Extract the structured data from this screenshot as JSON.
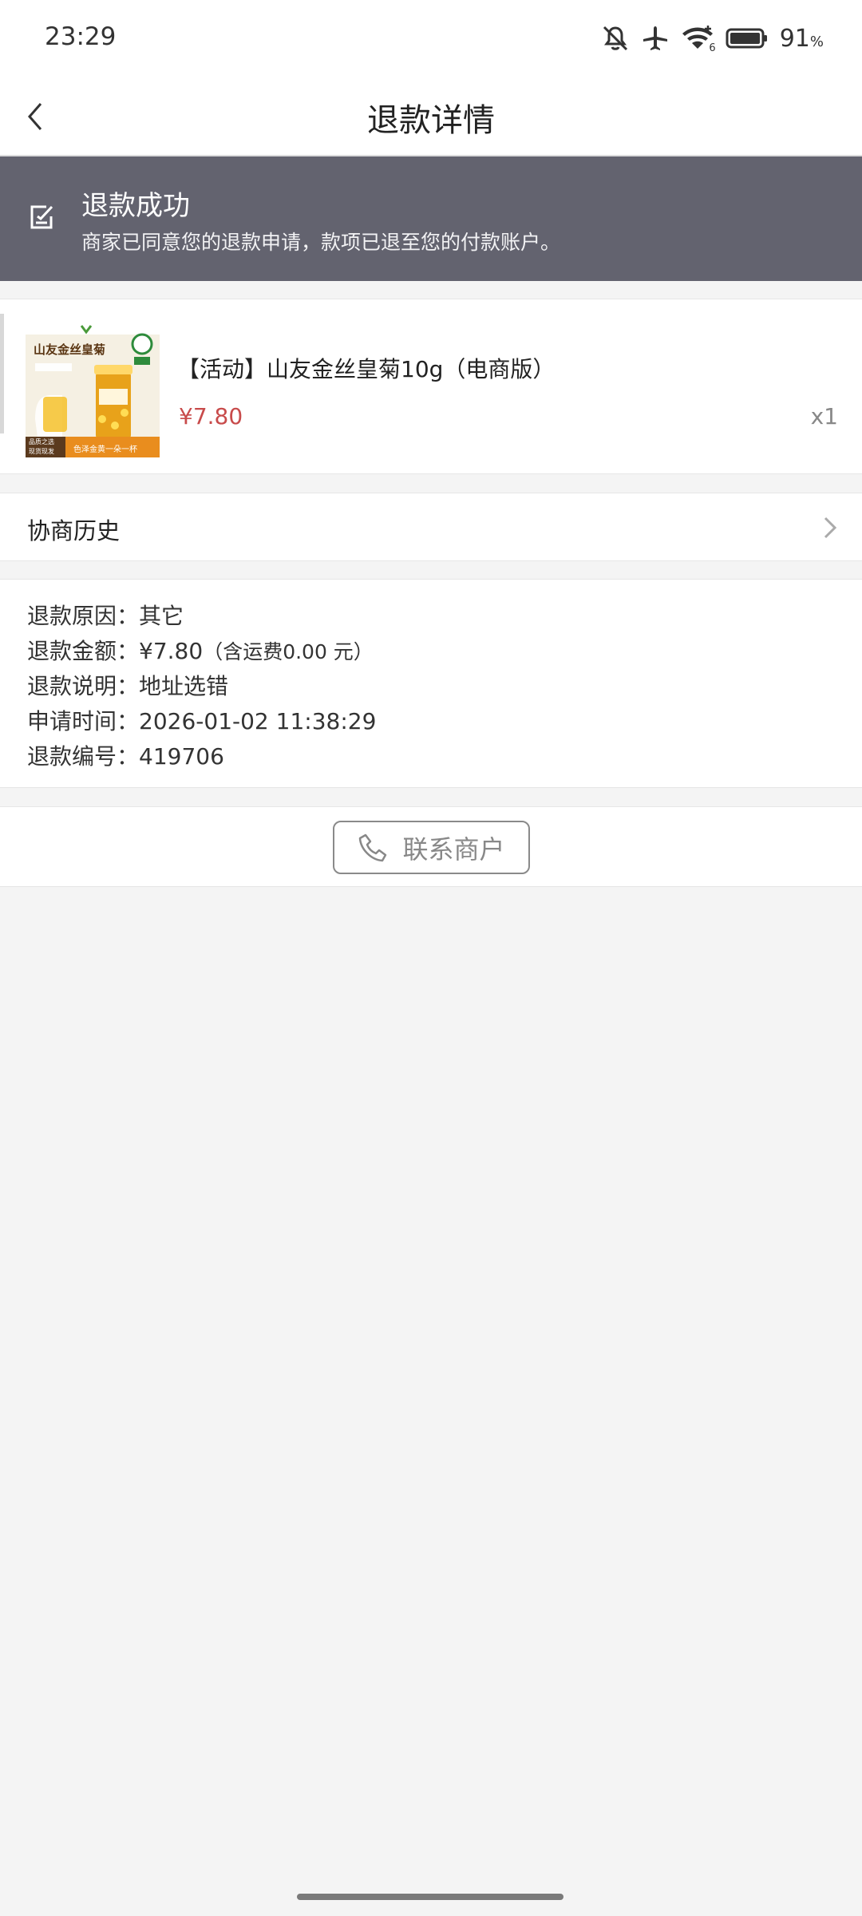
{
  "status_bar": {
    "time": "23:29",
    "battery_percent": "91",
    "battery_unit": "%",
    "wifi_badge": "6",
    "icons": [
      "mute-bell-icon",
      "airplane-icon",
      "wifi-icon",
      "battery-icon"
    ]
  },
  "header": {
    "title": "退款详情"
  },
  "banner": {
    "title": "退款成功",
    "subtitle": "商家已同意您的退款申请，款项已退至您的付款账户。",
    "background": "#63636f"
  },
  "product": {
    "name": "【活动】山友金丝皇菊10g（电商版）",
    "price": "¥7.80",
    "quantity": "x1",
    "thumb_text": {
      "title": "山友金丝皇菊",
      "tag_left_1": "品质之选",
      "tag_left_2": "现货现发",
      "tag_right": "色泽金黄一朵一杯"
    }
  },
  "history": {
    "label": "协商历史"
  },
  "refund_info": {
    "reason_label": "退款原因：",
    "reason_value": "其它",
    "amount_label": "退款金额：",
    "amount_value": "¥7.80",
    "amount_note": "（含运费0.00 元）",
    "desc_label": "退款说明：",
    "desc_value": "地址选错",
    "time_label": "申请时间：",
    "time_value": "2026-01-02 11:38:29",
    "id_label": "退款编号：",
    "id_value": "419706"
  },
  "contact": {
    "label": "联系商户"
  },
  "colors": {
    "price": "#c84b4b",
    "page_bg": "#f4f4f4"
  }
}
